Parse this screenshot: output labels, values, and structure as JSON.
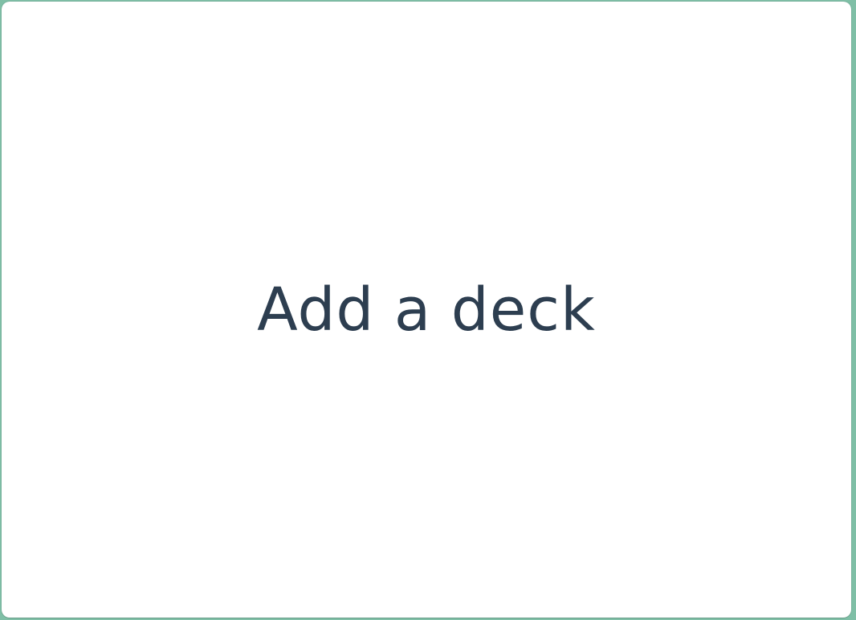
{
  "card": {
    "label": "Add a deck"
  },
  "colors": {
    "background": "#7fbfa6",
    "card": "#ffffff",
    "text": "#2d3e50"
  }
}
